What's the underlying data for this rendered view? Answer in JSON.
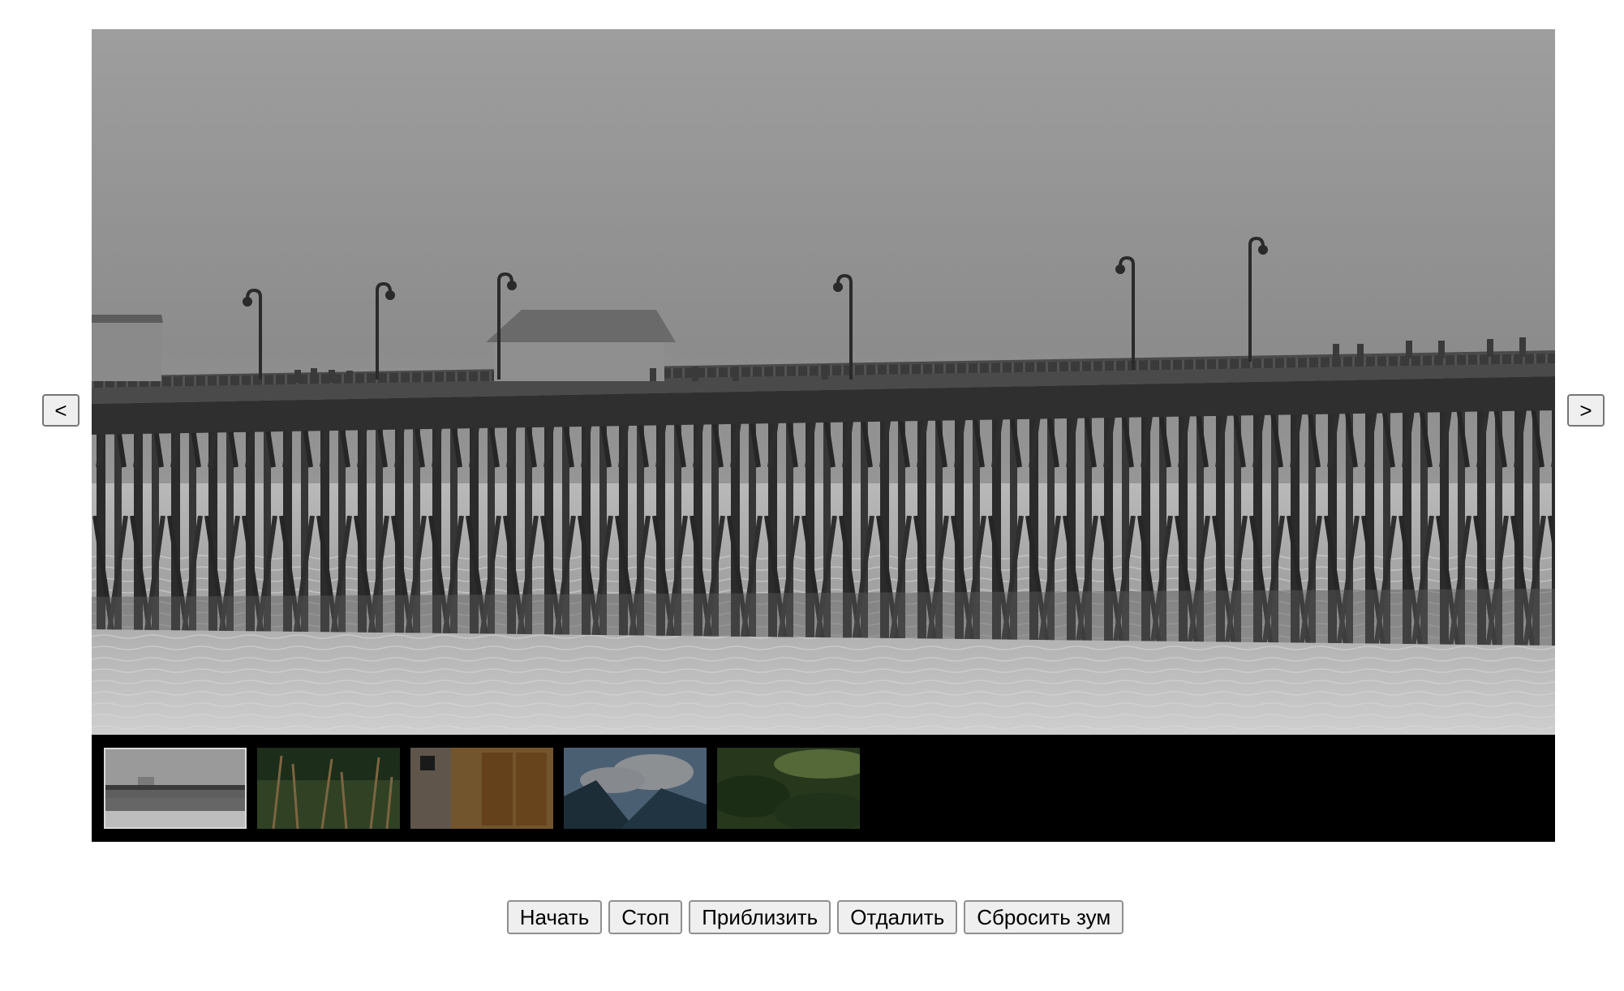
{
  "gallery": {
    "prev_label": "<",
    "next_label": ">",
    "main_image": {
      "subject": "pier-over-water",
      "tone": "grayscale"
    },
    "thumbnails": [
      {
        "subject": "pier-over-water",
        "active": true
      },
      {
        "subject": "tall-grass"
      },
      {
        "subject": "wooden-door"
      },
      {
        "subject": "mountains-clouds"
      },
      {
        "subject": "forest-hills"
      }
    ]
  },
  "controls": {
    "start_label": "Начать",
    "stop_label": "Стоп",
    "zoom_in_label": "Приблизить",
    "zoom_out_label": "Отдалить",
    "reset_zoom_label": "Сбросить зум"
  },
  "colors": {
    "page_background": "#ffffff",
    "thumb_strip_background": "#000000",
    "active_thumb_border": "#d9d9d9"
  }
}
